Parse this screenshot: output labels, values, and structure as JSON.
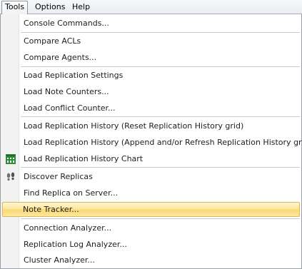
{
  "menubar": {
    "tools": "Tools",
    "options": "Options",
    "help": "Help"
  },
  "menu": {
    "console_commands": "Console Commands...",
    "compare_acls": "Compare ACLs",
    "compare_agents": "Compare Agents...",
    "load_replication_settings": "Load Replication Settings",
    "load_note_counters": "Load Note Counters...",
    "load_conflict_counter": "Load Conflict Counter...",
    "load_history_reset": "Load Replication History (Reset Replication History grid)",
    "load_history_append": "Load Replication History (Append and/or Refresh Replication History grid)",
    "load_history_chart": "Load Replication History Chart",
    "discover_replicas": "Discover Replicas",
    "find_replica": "Find Replica on Server...",
    "note_tracker": "Note Tracker...",
    "connection_analyzer": "Connection Analyzer...",
    "replication_log_analyzer": "Replication Log Analyzer...",
    "cluster_analyzer": "Cluster Analyzer..."
  },
  "icons": {
    "chart": "chart-icon",
    "discover": "footprints-icon"
  },
  "colors": {
    "highlight": "#fce59a",
    "chart_icon": "#2e8b3a"
  }
}
